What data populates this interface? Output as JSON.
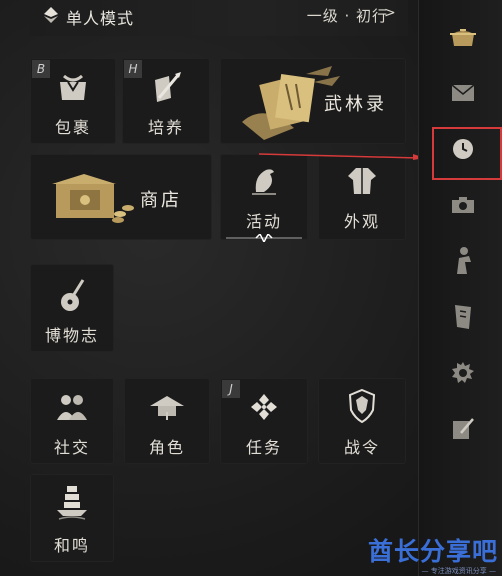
{
  "header": {
    "mode_label": "单人模式",
    "level_label": "一级 · 初行",
    "level_arrow": ">"
  },
  "tiles": {
    "bag": {
      "label": "包裹",
      "hotkey": "B"
    },
    "cultivate": {
      "label": "培养",
      "hotkey": "H"
    },
    "wulin": {
      "label": "武林录"
    },
    "shop": {
      "label": "商店"
    },
    "activity": {
      "label": "活动"
    },
    "appearance": {
      "label": "外观"
    },
    "museum": {
      "label": "博物志"
    },
    "social": {
      "label": "社交"
    },
    "character": {
      "label": "角色"
    },
    "task": {
      "label": "任务",
      "hotkey": "J"
    },
    "battlepass": {
      "label": "战令"
    },
    "heming": {
      "label": "和鸣"
    }
  },
  "rail": {
    "items": [
      {
        "icon": "teapot-icon"
      },
      {
        "icon": "mail-icon"
      },
      {
        "icon": "clock-icon"
      },
      {
        "icon": "camera-icon"
      },
      {
        "icon": "figure-icon"
      },
      {
        "icon": "scroll-icon"
      },
      {
        "icon": "gear-icon"
      },
      {
        "icon": "edit-note-icon"
      }
    ]
  },
  "colors": {
    "accent_gold": "#b89a5c",
    "highlight_red": "#d63a3a",
    "watermark_blue": "#3a6fd8"
  },
  "watermark": {
    "main": "酋长分享吧",
    "sub": "— 专注游戏资讯分享 —"
  }
}
